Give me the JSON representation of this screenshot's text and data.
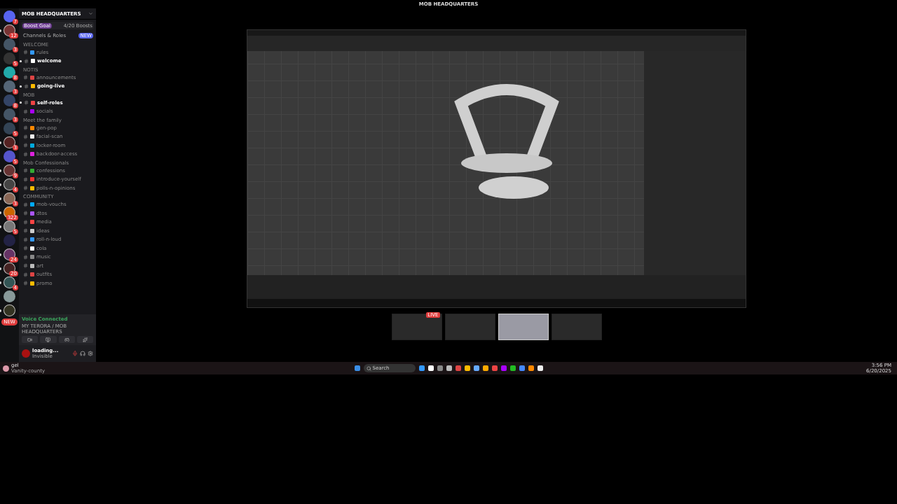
{
  "window": {
    "title": "MOB HEADQUARTERS"
  },
  "server": {
    "name": "MOB HEADQUARTERS",
    "boost_goal": "Boost Goal",
    "boost_count": "4/20 Boosts",
    "channels_roles": "Channels & Roles",
    "new_badge": "NEW"
  },
  "server_rail": [
    {
      "badge": "7",
      "unread": false
    },
    {
      "badge": "12",
      "unread": true
    },
    {
      "badge": "3",
      "unread": false
    },
    {
      "badge": "5",
      "unread": false
    },
    {
      "badge": "8",
      "unread": false
    },
    {
      "badge": "3",
      "unread": false
    },
    {
      "badge": "8",
      "unread": false
    },
    {
      "badge": "3",
      "unread": false
    },
    {
      "badge": "5",
      "unread": false
    },
    {
      "badge": "3",
      "unread": true
    },
    {
      "badge": "5",
      "unread": false
    },
    {
      "badge": "9",
      "unread": true
    },
    {
      "badge": "4",
      "unread": true
    },
    {
      "badge": "3",
      "unread": true
    },
    {
      "badge": "322",
      "unread": true
    },
    {
      "badge": "5",
      "unread": true
    },
    {
      "unread": false
    },
    {
      "badge": "24",
      "unread": true
    },
    {
      "badge": "20",
      "unread": true
    },
    {
      "badge": "4",
      "unread": true
    },
    {
      "unread": false
    },
    {
      "unread": true
    }
  ],
  "rail_new_badge": "NEW",
  "categories": [
    {
      "name": "WELCOME",
      "channels": [
        {
          "name": "rules",
          "unread": false
        },
        {
          "name": "welcome",
          "unread": true
        }
      ]
    },
    {
      "name": "NOTIS",
      "channels": [
        {
          "name": "announcements",
          "unread": false
        },
        {
          "name": "going-live",
          "unread": true
        }
      ]
    },
    {
      "name": "MOB",
      "channels": [
        {
          "name": "self-roles",
          "unread": true
        },
        {
          "name": "socials",
          "unread": false
        }
      ]
    },
    {
      "name": "Meet the family",
      "channels": [
        {
          "name": "gen-pop",
          "unread": false
        },
        {
          "name": "facial-scan",
          "unread": false
        },
        {
          "name": "locker-room",
          "unread": false
        },
        {
          "name": "backdoor-access",
          "unread": false
        }
      ]
    },
    {
      "name": "Mob Confessionals",
      "channels": [
        {
          "name": "confessions",
          "unread": false
        },
        {
          "name": "introduce-yourself",
          "unread": false
        },
        {
          "name": "polls-n-opinions",
          "unread": false
        }
      ]
    },
    {
      "name": "COMMUNITY",
      "channels": [
        {
          "name": "mob-vouchs",
          "unread": false
        },
        {
          "name": "dtos",
          "unread": false
        },
        {
          "name": "media",
          "unread": false
        },
        {
          "name": "ideas",
          "unread": false
        },
        {
          "name": "roll-n-loud",
          "unread": false
        },
        {
          "name": "cola",
          "unread": false
        },
        {
          "name": "music",
          "unread": false
        },
        {
          "name": "art",
          "unread": false
        },
        {
          "name": "outfits",
          "unread": false
        },
        {
          "name": "promo",
          "unread": false
        }
      ]
    }
  ],
  "voice": {
    "status": "Voice Connected",
    "channel": "MY TERORA / MOB HEADQUARTERS"
  },
  "user": {
    "name": "loading...",
    "status": "Invisible",
    "muted": true
  },
  "bottom_user": {
    "name": "gel",
    "status": "Vanity-county"
  },
  "stream_tiles": [
    {
      "selected": false,
      "live": true
    },
    {
      "selected": false,
      "live": false
    },
    {
      "selected": true,
      "live": false
    },
    {
      "selected": false,
      "live": false
    }
  ],
  "live_badge": "LIVE",
  "taskbar": {
    "search": "Search",
    "time": "3:56 PM",
    "date": "6/20/2025"
  }
}
